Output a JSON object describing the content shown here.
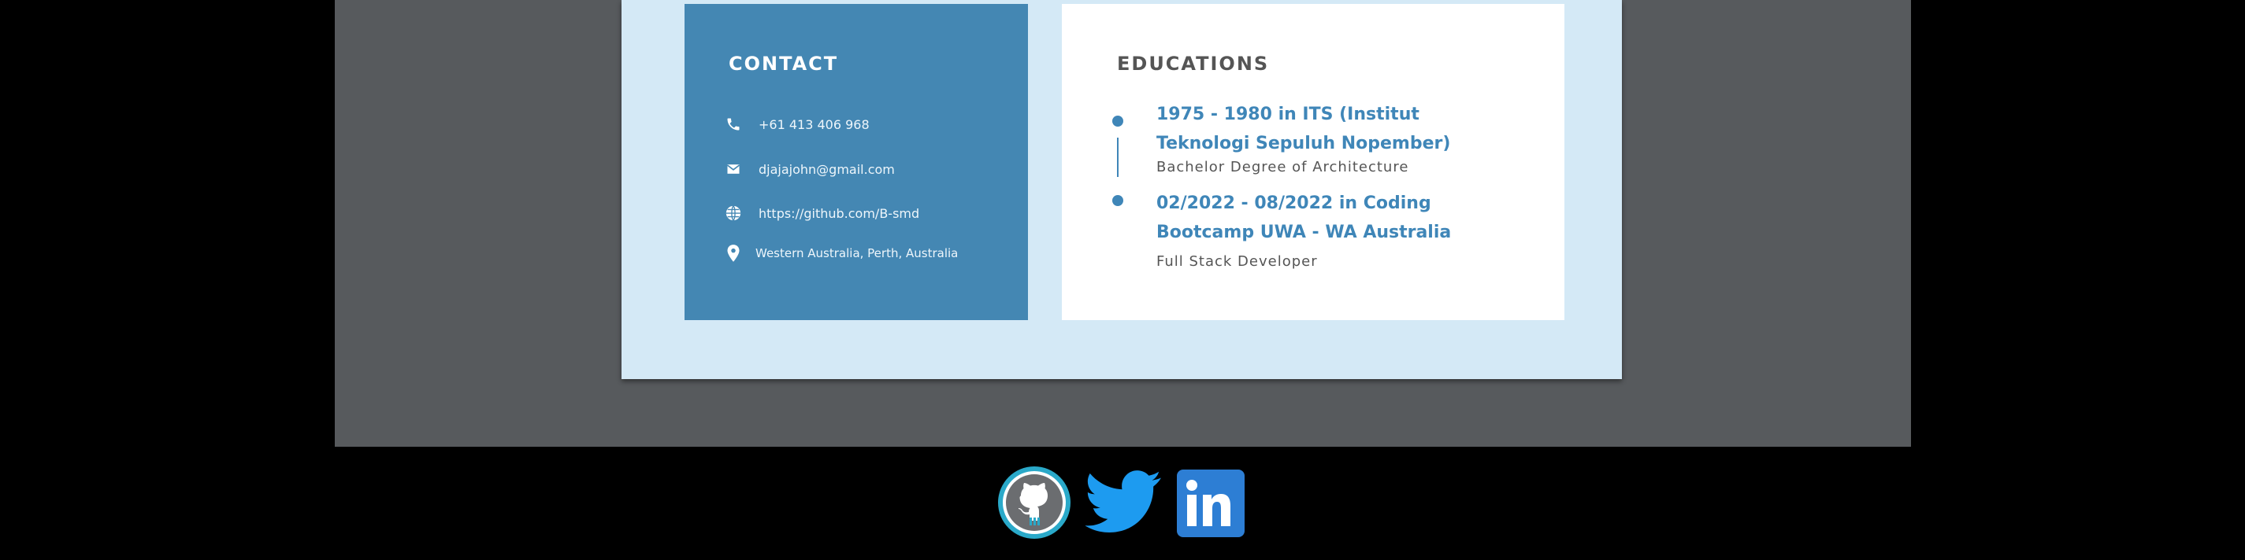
{
  "contact": {
    "heading": "CONTACT",
    "items": [
      {
        "icon": "phone-icon",
        "text": "+61 413 406 968"
      },
      {
        "icon": "mail-icon",
        "text": "djajajohn@gmail.com"
      },
      {
        "icon": "globe-icon",
        "text": "https://github.com/B-smd"
      },
      {
        "icon": "location-pin-icon",
        "text": "Western Australia, Perth, Australia"
      }
    ]
  },
  "education": {
    "heading": "EDUCATIONS",
    "items": [
      {
        "title": "1975 - 1980 in ITS (Institut Teknologi Sepuluh Nopember)",
        "subtitle": "Bachelor Degree of Architecture"
      },
      {
        "title": "02/2022 - 08/2022 in Coding Bootcamp UWA - WA Australia",
        "subtitle": "Full Stack Developer"
      }
    ]
  },
  "social": [
    {
      "icon": "github-icon",
      "color": "#2aa9c9"
    },
    {
      "icon": "twitter-icon",
      "color": "#1d9bf0"
    },
    {
      "icon": "linkedin-icon",
      "color": "#2d7ed4"
    }
  ],
  "colors": {
    "contact_bg": "#4487b3",
    "accent": "#3f86b8",
    "sheet_bg": "#d4e9f6",
    "panel_bg": "#575a5d"
  }
}
